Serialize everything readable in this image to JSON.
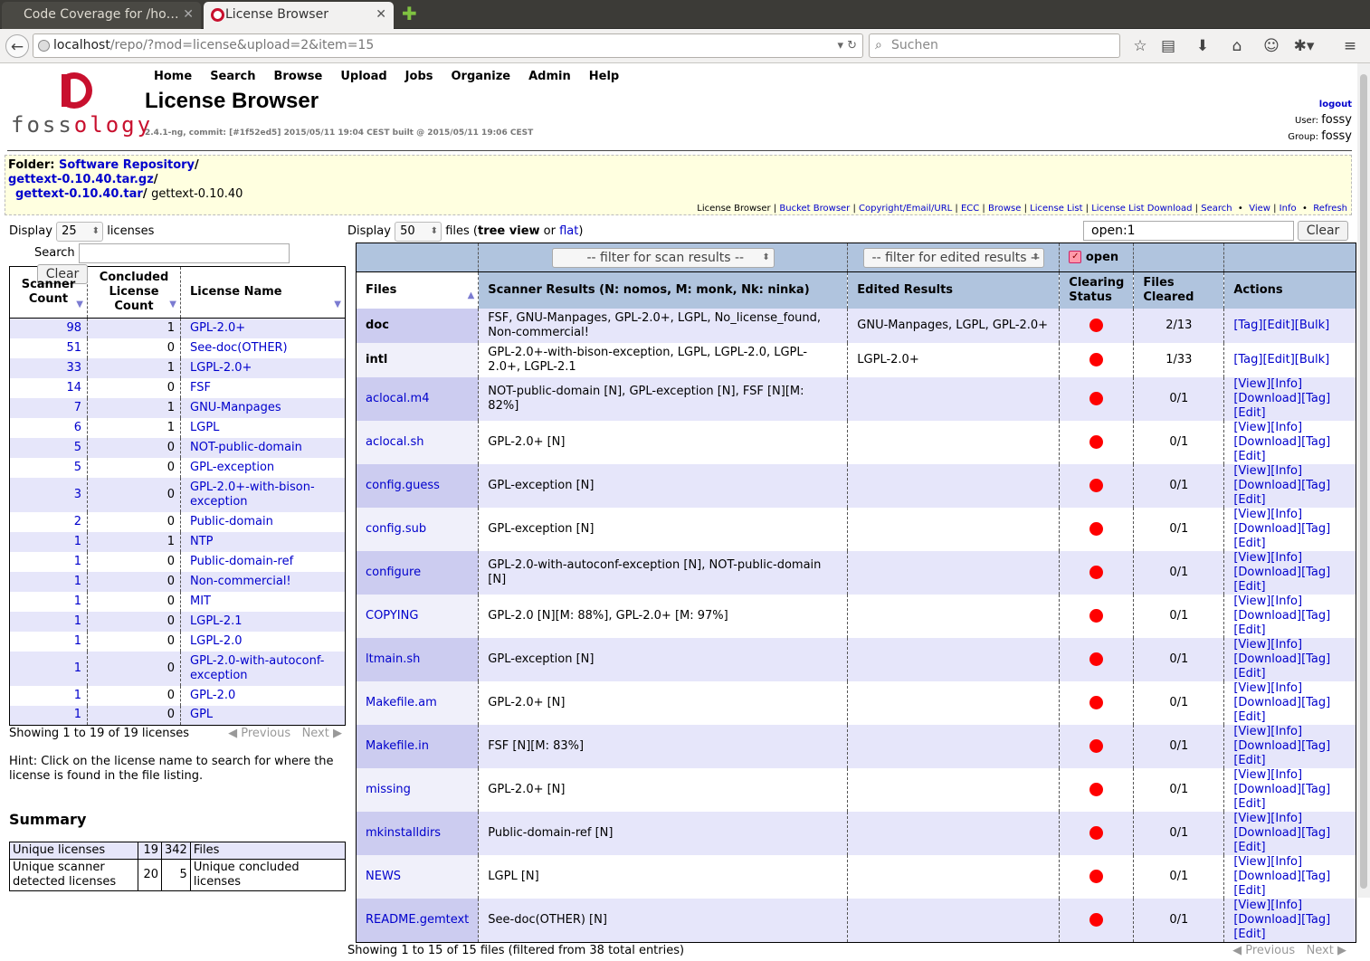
{
  "browser": {
    "tabs": [
      {
        "label": "Code Coverage for /ho…"
      },
      {
        "label": "License Browser"
      }
    ],
    "url_host": "localhost",
    "url_path": "/repo/?mod=license&upload=2&item=15",
    "search_placeholder": "Suchen"
  },
  "header": {
    "logo_text_pre": "foss",
    "logo_text_post": "ology",
    "menu": [
      "Home",
      "Search",
      "Browse",
      "Upload",
      "Jobs",
      "Organize",
      "Admin",
      "Help"
    ],
    "title": "License Browser",
    "version": "2.4.1-ng, commit: [#1f52ed5] 2015/05/11 19:04 CEST built @ 2015/05/11 19:06 CEST",
    "logout": "logout",
    "user_label": "User:",
    "user": "fossy",
    "group_label": "Group:",
    "group": "fossy"
  },
  "folder": {
    "label": "Folder",
    "repo": "Software Repository",
    "archive": "gettext-0.10.40.tar.gz",
    "tar": "gettext-0.10.40.tar",
    "current": "gettext-0.10.40",
    "links": [
      "License Browser",
      "Bucket Browser",
      "Copyright/Email/URL",
      "ECC",
      "Browse",
      "License List",
      "License List Download",
      "Search",
      "View",
      "Info",
      "Refresh"
    ]
  },
  "left": {
    "display_label": "Display",
    "display_value": "25",
    "display_suffix": "licenses",
    "search_label": "Search",
    "clear_label": "Clear",
    "columns": [
      "Scanner Count",
      "Concluded License Count",
      "License Name"
    ],
    "rows": [
      {
        "sc": "98",
        "cc": "1",
        "name": "GPL-2.0+"
      },
      {
        "sc": "51",
        "cc": "0",
        "name": "See-doc(OTHER)"
      },
      {
        "sc": "33",
        "cc": "1",
        "name": "LGPL-2.0+"
      },
      {
        "sc": "14",
        "cc": "0",
        "name": "FSF"
      },
      {
        "sc": "7",
        "cc": "1",
        "name": "GNU-Manpages"
      },
      {
        "sc": "6",
        "cc": "1",
        "name": "LGPL"
      },
      {
        "sc": "5",
        "cc": "0",
        "name": "NOT-public-domain"
      },
      {
        "sc": "5",
        "cc": "0",
        "name": "GPL-exception"
      },
      {
        "sc": "3",
        "cc": "0",
        "name": "GPL-2.0+-with-bison-exception"
      },
      {
        "sc": "2",
        "cc": "0",
        "name": "Public-domain"
      },
      {
        "sc": "1",
        "cc": "1",
        "name": "NTP"
      },
      {
        "sc": "1",
        "cc": "0",
        "name": "Public-domain-ref"
      },
      {
        "sc": "1",
        "cc": "0",
        "name": "Non-commercial!"
      },
      {
        "sc": "1",
        "cc": "0",
        "name": "MIT"
      },
      {
        "sc": "1",
        "cc": "0",
        "name": "LGPL-2.1"
      },
      {
        "sc": "1",
        "cc": "0",
        "name": "LGPL-2.0"
      },
      {
        "sc": "1",
        "cc": "0",
        "name": "GPL-2.0-with-autoconf-exception"
      },
      {
        "sc": "1",
        "cc": "0",
        "name": "GPL-2.0"
      },
      {
        "sc": "1",
        "cc": "0",
        "name": "GPL"
      }
    ],
    "showing": "Showing 1 to 19 of 19 licenses",
    "previous": "Previous",
    "next": "Next",
    "hint": "Hint: Click on the license name to search for where the license is found in the file listing.",
    "summary_title": "Summary",
    "summary": [
      {
        "label": "Unique licenses",
        "v1": "19",
        "v2": "342",
        "label2": "Files"
      },
      {
        "label": "Unique scanner detected licenses",
        "v1": "20",
        "v2": "5",
        "label2": "Unique concluded licenses"
      }
    ]
  },
  "right": {
    "display_label": "Display",
    "display_value": "50",
    "files_text": "files (",
    "tree_view": "tree view",
    "or_text": " or ",
    "flat": "flat",
    "close_paren": ")",
    "search_value": "open:1",
    "clear_label": "Clear",
    "filter_scan": "-- filter for scan results --",
    "filter_edit": "-- filter for edited results --",
    "open_label": "open",
    "columns": [
      "Files",
      "Scanner Results (N: nomos, M: monk, Nk: ninka)",
      "Edited Results",
      "Clearing Status",
      "Files Cleared",
      "Actions"
    ],
    "rows": [
      {
        "file": "doc",
        "bold": true,
        "scan": "FSF, GNU-Manpages, GPL-2.0+, LGPL, No_license_found, Non-commercial!",
        "edited": "GNU-Manpages, LGPL, GPL-2.0+",
        "cleared": "2/13",
        "a1": "[Tag][Edit][Bulk]",
        "a2": ""
      },
      {
        "file": "intl",
        "bold": true,
        "scan": "GPL-2.0+-with-bison-exception, LGPL, LGPL-2.0, LGPL-2.0+, LGPL-2.1",
        "edited": "LGPL-2.0+",
        "cleared": "1/33",
        "a1": "[Tag][Edit][Bulk]",
        "a2": ""
      },
      {
        "file": "aclocal.m4",
        "bold": false,
        "scan": "NOT-public-domain [N], GPL-exception [N], FSF [N][M: 82%]",
        "edited": "",
        "cleared": "0/1",
        "a1": "[View][Info]",
        "a2": "[Download][Tag][Edit]"
      },
      {
        "file": "aclocal.sh",
        "bold": false,
        "scan": "GPL-2.0+ [N]",
        "edited": "",
        "cleared": "0/1",
        "a1": "[View][Info]",
        "a2": "[Download][Tag][Edit]"
      },
      {
        "file": "config.guess",
        "bold": false,
        "scan": "GPL-exception [N]",
        "edited": "",
        "cleared": "0/1",
        "a1": "[View][Info]",
        "a2": "[Download][Tag][Edit]"
      },
      {
        "file": "config.sub",
        "bold": false,
        "scan": "GPL-exception [N]",
        "edited": "",
        "cleared": "0/1",
        "a1": "[View][Info]",
        "a2": "[Download][Tag][Edit]"
      },
      {
        "file": "configure",
        "bold": false,
        "scan": "GPL-2.0-with-autoconf-exception [N], NOT-public-domain [N]",
        "edited": "",
        "cleared": "0/1",
        "a1": "[View][Info]",
        "a2": "[Download][Tag][Edit]"
      },
      {
        "file": "COPYING",
        "bold": false,
        "scan": "GPL-2.0 [N][M: 88%], GPL-2.0+ [M: 97%]",
        "edited": "",
        "cleared": "0/1",
        "a1": "[View][Info]",
        "a2": "[Download][Tag][Edit]"
      },
      {
        "file": "ltmain.sh",
        "bold": false,
        "scan": "GPL-exception [N]",
        "edited": "",
        "cleared": "0/1",
        "a1": "[View][Info]",
        "a2": "[Download][Tag][Edit]"
      },
      {
        "file": "Makefile.am",
        "bold": false,
        "scan": "GPL-2.0+ [N]",
        "edited": "",
        "cleared": "0/1",
        "a1": "[View][Info]",
        "a2": "[Download][Tag][Edit]"
      },
      {
        "file": "Makefile.in",
        "bold": false,
        "scan": "FSF [N][M: 83%]",
        "edited": "",
        "cleared": "0/1",
        "a1": "[View][Info]",
        "a2": "[Download][Tag][Edit]"
      },
      {
        "file": "missing",
        "bold": false,
        "scan": "GPL-2.0+ [N]",
        "edited": "",
        "cleared": "0/1",
        "a1": "[View][Info]",
        "a2": "[Download][Tag][Edit]"
      },
      {
        "file": "mkinstalldirs",
        "bold": false,
        "scan": "Public-domain-ref [N]",
        "edited": "",
        "cleared": "0/1",
        "a1": "[View][Info]",
        "a2": "[Download][Tag][Edit]"
      },
      {
        "file": "NEWS",
        "bold": false,
        "scan": "LGPL [N]",
        "edited": "",
        "cleared": "0/1",
        "a1": "[View][Info]",
        "a2": "[Download][Tag][Edit]"
      },
      {
        "file": "README.gemtext",
        "bold": false,
        "scan": "See-doc(OTHER) [N]",
        "edited": "",
        "cleared": "0/1",
        "a1": "[View][Info]",
        "a2": "[Download][Tag][Edit]"
      }
    ],
    "showing": "Showing 1 to 15 of 15 files (filtered from 38 total entries)",
    "previous": "Previous",
    "next": "Next"
  },
  "colors": {
    "row_alt": "#e6e6fa",
    "header_bg": "#b0c4de",
    "folder_bg": "#ffffe0",
    "status_red": "#ff0000",
    "brand": "#c8102e"
  }
}
